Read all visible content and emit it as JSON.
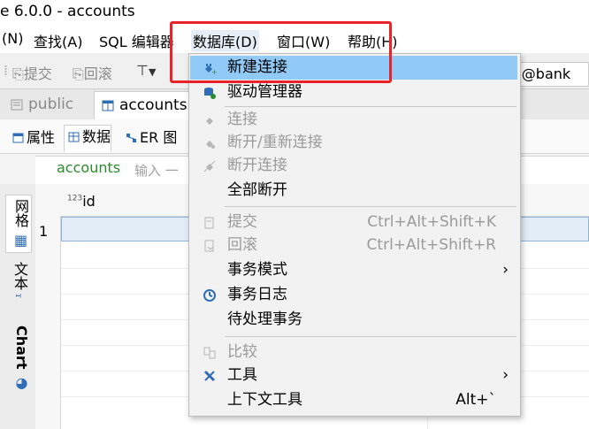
{
  "window": {
    "title": "e 6.0.0 - accounts"
  },
  "menubar": {
    "items": [
      "(N)",
      "查找(A)",
      "SQL 编辑器",
      "数据库(D)",
      "窗口(W)",
      "帮助(H)"
    ]
  },
  "toolbar": {
    "commit_label": "提交",
    "rollback_label": "回滚",
    "connection_label": "c@bank"
  },
  "editor_tabs": {
    "tab1": "public",
    "tab2": "accounts"
  },
  "sub_tabs": {
    "properties": "属性",
    "data": "数据",
    "er": "ER 图"
  },
  "filter": {
    "table": "accounts",
    "placeholder": "输入 一"
  },
  "side_tabs": {
    "grid": "网格",
    "text": "文本",
    "chart": "Chart"
  },
  "grid": {
    "column_header": "id",
    "type_prefix": "123",
    "row_number": "1"
  },
  "menu": {
    "new_connection": "新建连接",
    "driver_manager": "驱动管理器",
    "connect": "连接",
    "reconnect": "断开/重新连接",
    "disconnect": "断开连接",
    "disconnect_all": "全部断开",
    "commit": "提交",
    "commit_shortcut": "Ctrl+Alt+Shift+K",
    "rollback": "回滚",
    "rollback_shortcut": "Ctrl+Alt+Shift+R",
    "transaction_mode": "事务模式",
    "transaction_log": "事务日志",
    "pending_transactions": "待处理事务",
    "compare": "比较",
    "tools": "工具",
    "context_tools": "上下文工具",
    "context_tools_shortcut": "Alt+`"
  },
  "colors": {
    "highlight": "#91c9f7",
    "annotation_box": "#e8242a"
  }
}
